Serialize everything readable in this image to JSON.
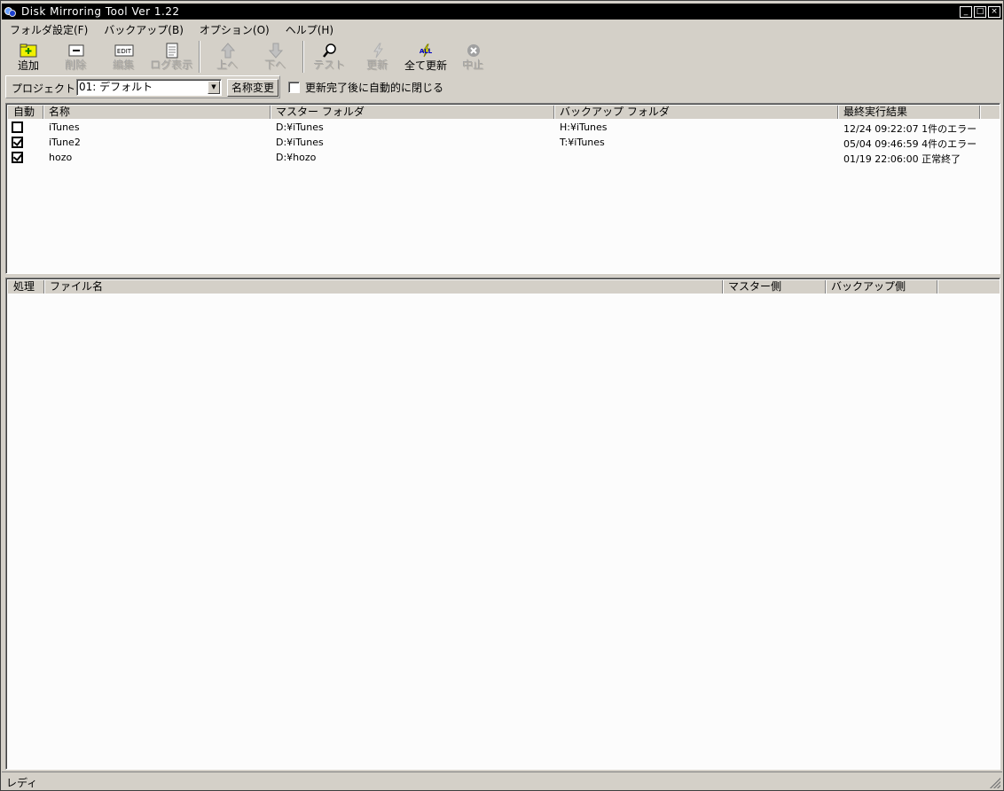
{
  "window": {
    "title": "Disk Mirroring Tool Ver 1.22"
  },
  "menu": [
    {
      "label": "フォルダ設定(F)"
    },
    {
      "label": "バックアップ(B)"
    },
    {
      "label": "オプション(O)"
    },
    {
      "label": "ヘルプ(H)"
    }
  ],
  "toolbar": {
    "add": "追加",
    "delete": "削除",
    "edit": "編集",
    "log": "ログ表示",
    "up": "上へ",
    "down": "下へ",
    "test": "テスト",
    "update": "更新",
    "update_all": "全て更新",
    "stop": "中止",
    "edit_icon_text": "EDIT",
    "all_icon_text": "ALL"
  },
  "project": {
    "label": "プロジェクト",
    "selected": "01: デフォルト",
    "rename_button": "名称変更",
    "auto_close_label": "更新完了後に自動的に閉じる",
    "auto_close_checked": false
  },
  "folders": {
    "columns": [
      "自動",
      "名称",
      "マスター フォルダ",
      "バックアップ フォルダ",
      "最終実行結果"
    ],
    "rows": [
      {
        "auto": false,
        "name": "iTunes",
        "master": "D:¥iTunes",
        "backup": "H:¥iTunes",
        "result": "12/24 09:22:07 1件のエラー"
      },
      {
        "auto": true,
        "name": "iTune2",
        "master": "D:¥iTunes",
        "backup": "T:¥iTunes",
        "result": "05/04 09:46:59 4件のエラー"
      },
      {
        "auto": true,
        "name": "hozo",
        "master": "D:¥hozo",
        "backup": "",
        "result": "01/19 22:06:00 正常終了"
      }
    ]
  },
  "files": {
    "columns": [
      "処理",
      "ファイル名",
      "マスター側",
      "バックアップ側"
    ]
  },
  "status": {
    "text": "レディ"
  }
}
